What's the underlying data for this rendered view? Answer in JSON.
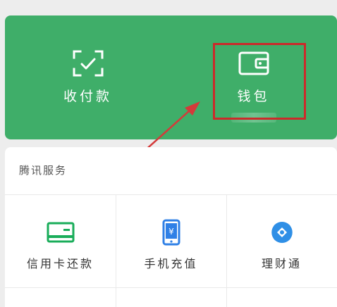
{
  "quick_actions": {
    "pay": {
      "label": "收付款",
      "icon": "qr-scan-check-icon"
    },
    "wallet": {
      "label": "钱包",
      "icon": "wallet-icon"
    }
  },
  "services": {
    "title": "腾讯服务",
    "items": [
      {
        "label": "信用卡还款",
        "icon": "credit-card-icon",
        "color": "#1aad5a"
      },
      {
        "label": "手机充值",
        "icon": "phone-topup-icon",
        "color": "#2f80e6"
      },
      {
        "label": "理财通",
        "icon": "licaitong-icon",
        "color": "#2f8fe6"
      }
    ]
  },
  "colors": {
    "card_green": "#3fae69",
    "highlight_red": "#cc2a2a",
    "page_bg": "#ededed"
  }
}
